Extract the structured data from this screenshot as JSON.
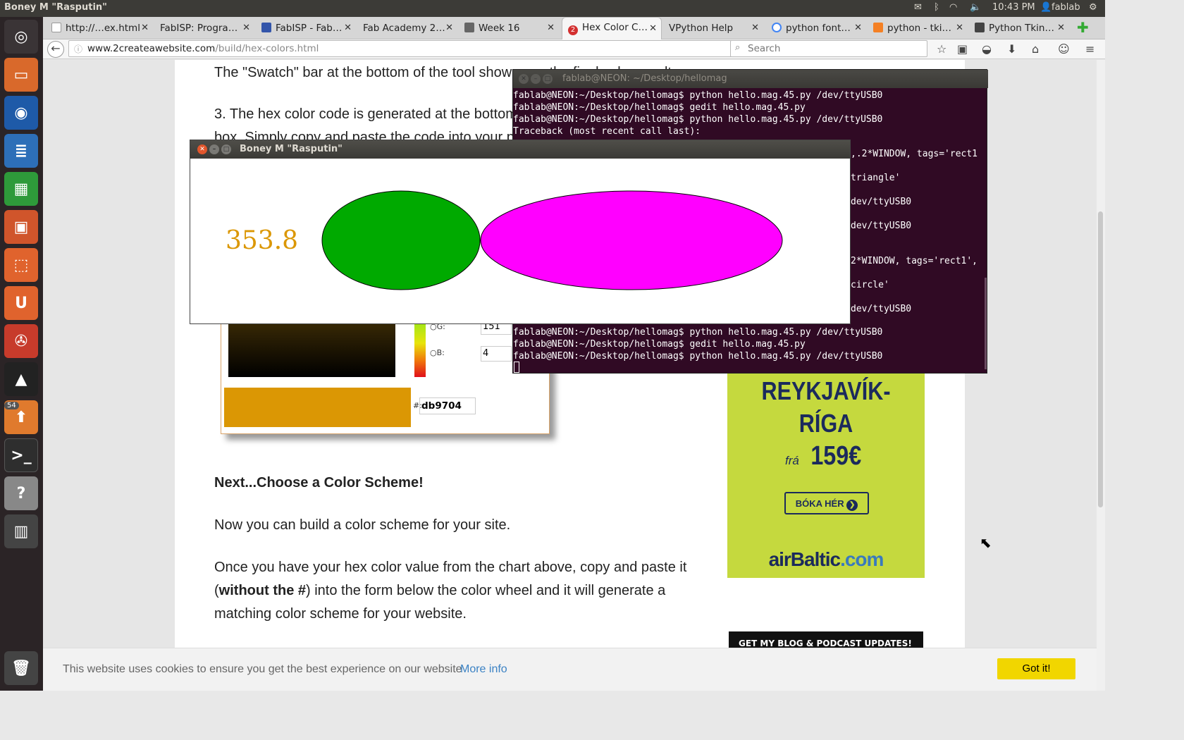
{
  "topbar": {
    "window_title": "Boney M \"Rasputin\"",
    "time": "10:43 PM",
    "user": "fablab"
  },
  "launcher": {
    "badge": "54",
    "icons": [
      "ubuntu-dash-icon",
      "files-icon",
      "firefox-icon",
      "writer-icon",
      "calc-icon",
      "impress-icon",
      "software-center-icon",
      "ubuntu-one-icon",
      "system-settings-icon",
      "inkscape-icon",
      "updater-icon",
      "terminal-icon",
      "help-icon",
      "workspace-icon",
      "trash-icon"
    ]
  },
  "tabs": [
    {
      "label": "http://…ex.html",
      "fav_color": "#ffffff"
    },
    {
      "label": "FabISP: Progra…",
      "fav_color": "#ffffff"
    },
    {
      "label": "FabISP - Fab…",
      "fav_color": "#3355aa"
    },
    {
      "label": "Fab Academy 2…",
      "fav_color": "#ffffff"
    },
    {
      "label": "Week 16",
      "fav_color": "#666666"
    },
    {
      "label": "Hex Color C…",
      "fav_color": "#d32f2f",
      "badge": "2",
      "active": true
    },
    {
      "label": "VPython Help",
      "fav_color": "#ffffff"
    },
    {
      "label": "python font…",
      "fav_color": "#4285f4"
    },
    {
      "label": "python - tki…",
      "fav_color": "#f48024"
    },
    {
      "label": "Python Tkin…",
      "fav_color": "#444444"
    }
  ],
  "navbar": {
    "url_domain": "www.2createawebsite.com",
    "url_path": "/build/hex-colors.html",
    "search_placeholder": "Search"
  },
  "page": {
    "para_swatch": "The \"Swatch\" bar at the bottom of the tool shows you the final color result.",
    "para_hex_1": "3. The hex color code is generated at the bottom right",
    "para_hex_2": "box.  Simply copy and paste the code into your page.",
    "heading_scheme": "Next...Choose a Color Scheme!",
    "para_build": "Now you can build a color scheme for your site.",
    "para_once_1": "Once you have your hex color value from the chart above, copy and paste it",
    "para_once_2_pre": "(",
    "para_once_2_bold": "without the #",
    "para_once_2_post": ") into the form below the color wheel and it will generate a",
    "para_once_3": "matching color scheme for your website."
  },
  "color_tool": {
    "g_label": "G:",
    "g_value": "151",
    "b_label": "B:",
    "b_value": "4",
    "hash": "#:",
    "hex": "db9704",
    "swatch_color": "#db9704"
  },
  "ad": {
    "line1": "REYKJAVÍK-",
    "line2": "RÍGA",
    "from": "frá",
    "price": "159€",
    "button": "BÓKA HÉR",
    "brand": "airBaltic",
    "brand_tld": ".com"
  },
  "blog_bar": "GET MY BLOG & PODCAST UPDATES!",
  "cookie": {
    "text": "This website uses cookies to ensure you get the best experience on our website",
    "link": "More info",
    "button": "Got it!"
  },
  "terminal": {
    "title": "fablab@NEON: ~/Desktop/hellomag",
    "lines": [
      "fablab@NEON:~/Desktop/hellomag$ python hello.mag.45.py /dev/ttyUSB0",
      "fablab@NEON:~/Desktop/hellomag$ gedit hello.mag.45.py",
      "fablab@NEON:~/Desktop/hellomag$ python hello.mag.45.py /dev/ttyUSB0",
      "Traceback (most recent call last):"
    ],
    "visible_right": [
      ",.2*WINDOW, tags='rect1",
      "triangle'",
      "dev/ttyUSB0",
      "dev/ttyUSB0",
      "2*WINDOW, tags='rect1',",
      "circle'",
      "dev/ttyUSB0"
    ],
    "bottom_lines": [
      "fablab@NEON:~/Desktop/hellomag$ python hello.mag.45.py /dev/ttyUSB0",
      "fablab@NEON:~/Desktop/hellomag$ gedit hello.mag.45.py",
      "fablab@NEON:~/Desktop/hellomag$ python hello.mag.45.py /dev/ttyUSB0"
    ]
  },
  "tk_window": {
    "title": "Boney M \"Rasputin\"",
    "reading": "353.8",
    "reading_color": "#db9704",
    "ellipse_left_color": "#00aa00",
    "ellipse_right_color": "#ff00ff"
  }
}
